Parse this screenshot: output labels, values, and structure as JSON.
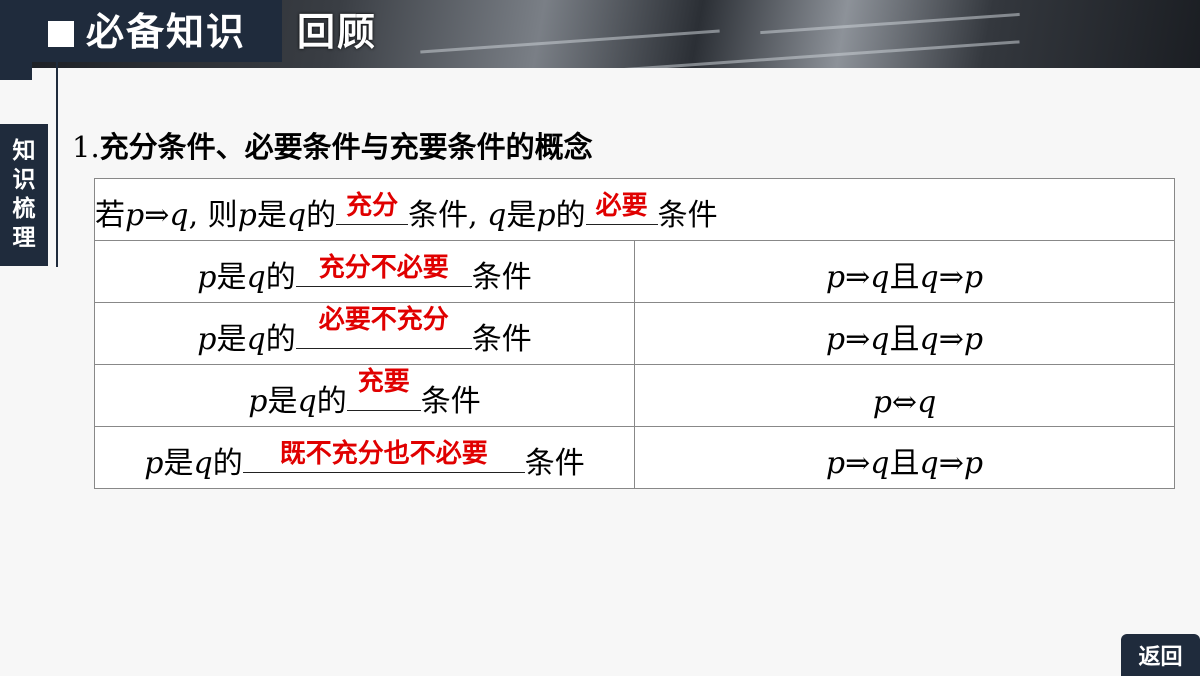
{
  "header": {
    "title": "必备知识",
    "subtitle": "回顾"
  },
  "side_tab": {
    "chars": [
      "知",
      "识",
      "梳",
      "理"
    ]
  },
  "section": {
    "number": "1.",
    "title": "充分条件、必要条件与充要条件的概念"
  },
  "table": {
    "row0": {
      "prefix": "若",
      "p1": "p",
      "arrow1": "⇒",
      "q1": "q",
      "comma1": ", 则",
      "p2": "p",
      "is1": "是",
      "q2": "q",
      "de1": "的",
      "answer1": "充分",
      "cond1": "条件",
      "comma2": ", ",
      "q3": "q",
      "is2": "是",
      "p3": "p",
      "de2": "的",
      "answer2": "必要",
      "cond2": "条件"
    },
    "rows": [
      {
        "p": "p",
        "is": "是",
        "q": "q",
        "de": "的",
        "answer": "充分不必要",
        "cond": "条件",
        "right": {
          "a": "p",
          "op1": "⇒",
          "b": "q",
          "and": "且",
          "c": "q",
          "op2": "⇒",
          "d": "p"
        }
      },
      {
        "p": "p",
        "is": "是",
        "q": "q",
        "de": "的",
        "answer": "必要不充分",
        "cond": "条件",
        "right": {
          "a": "p",
          "op1": "⇒",
          "b": "q",
          "and": "且",
          "c": "q",
          "op2": "⇒",
          "d": "p"
        }
      },
      {
        "p": "p",
        "is": "是",
        "q": "q",
        "de": "的",
        "answer": "充要",
        "cond": "条件",
        "right": {
          "a": "p",
          "op1": "⇔",
          "b": "q"
        }
      },
      {
        "p": "p",
        "is": "是",
        "q": "q",
        "de": "的",
        "answer": "既不充分也不必要",
        "cond": "条件",
        "right": {
          "a": "p",
          "op1": "⇒",
          "b": "q",
          "and": "且",
          "c": "q",
          "op2": "⇒",
          "d": "p"
        }
      }
    ]
  },
  "footer": {
    "back_label": "返回"
  },
  "colors": {
    "navy": "#1f2b3c",
    "answer_red": "#e00000",
    "border": "#888888"
  }
}
